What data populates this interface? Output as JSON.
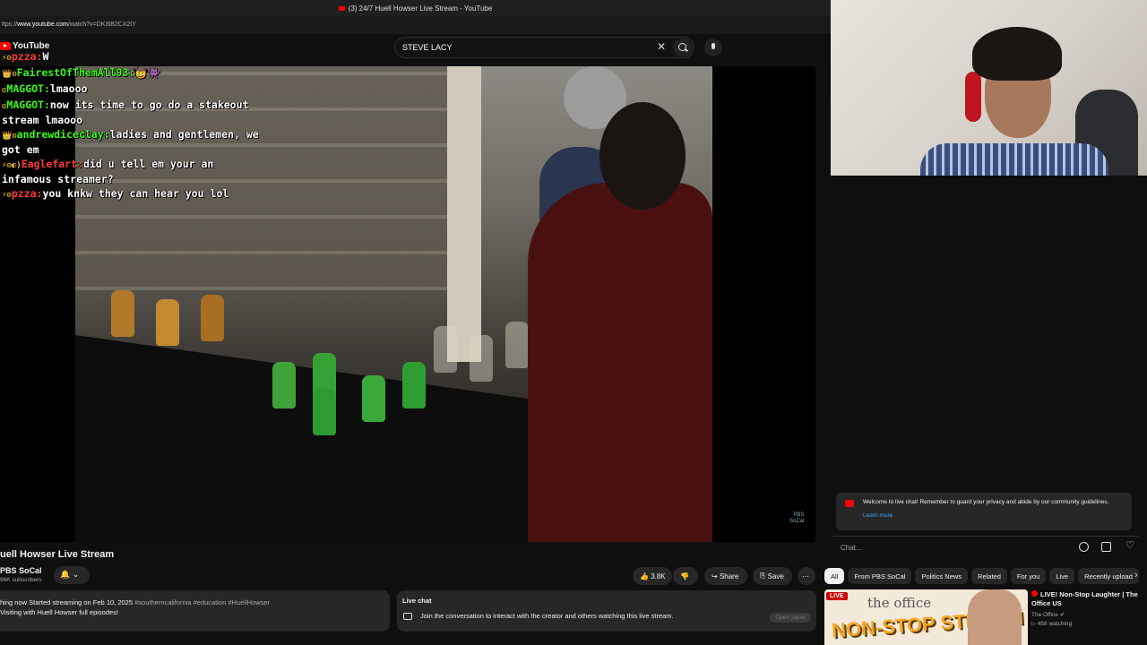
{
  "browser": {
    "tab_title": "(3) 24/7 Huell Howser Live Stream - YouTube",
    "url_prefix": "ttps://",
    "url_main": "www.youtube.com",
    "url_rest": "/watch?v=DKI6B2CX2tY"
  },
  "header": {
    "logo": "YouTube",
    "search_value": "STEVE LACY"
  },
  "chat_overlay": [
    {
      "badges": "⚡⚙",
      "user": "pzza:",
      "user_color": "#ff3b3b",
      "text": "W"
    },
    {
      "badges": "👑⚙",
      "user": "FairestOfThemAll93:",
      "user_color": "#39ff14",
      "text": "🤠👾"
    },
    {
      "badges": "◎",
      "user": "MAGGOT:",
      "user_color": "#39ff14",
      "text": "lmaooo"
    },
    {
      "badges": "◎",
      "user": "MAGGOT:",
      "user_color": "#39ff14",
      "text": "now its time to go do a stakeout stream lmaooo"
    },
    {
      "badges": "👑⚙",
      "user": "andrewdiceclay:",
      "user_color": "#39ff14",
      "text": "ladies and gentlemen, we got em"
    },
    {
      "badges": "⚡⚙◐)",
      "user": "Eaglefart:",
      "user_color": "#ff3b3b",
      "text": "did u tell em your an infamous streamer?"
    },
    {
      "badges": "⚡⚙",
      "user": "pzza:",
      "user_color": "#ff3b3b",
      "text": "you knkw they can hear you lol"
    }
  ],
  "video": {
    "watermark_line1": "PBS",
    "watermark_line2": "SoCal"
  },
  "meta": {
    "title": "uell Howser Live Stream",
    "channel": "PBS SoCal",
    "subscribers": "96K subscribers",
    "like_count": "3.8K",
    "share_label": "Share",
    "save_label": "Save",
    "description_line1_prefix": "hing now  Started streaming on Feb 10, 2025 ",
    "description_hashtags": "#southerncalifornia #education #HuellHowser",
    "description_line2": "Visiting with Huell Howser full episodes!"
  },
  "livechat_box": {
    "title": "Live chat",
    "join_text": "Join the conversation to interact with the creator and others watching this live stream.",
    "open_panel": "Open panel"
  },
  "chat_panel": {
    "welcome": "Welcome to live chat! Remember to guard your privacy and abide by our community guidelines.",
    "learn_more": "Learn more",
    "input_placeholder": "Chat..."
  },
  "chips": [
    "All",
    "From PBS SoCal",
    "Politics News",
    "Related",
    "For you",
    "Live",
    "Recently upload"
  ],
  "recommendation": {
    "live_badge": "LIVE",
    "thumb_line1": "the office",
    "thumb_line2": "NON-STOP STREAM",
    "title": "LIVE! Non-Stop Laughter | The Office US",
    "channel": "The Office",
    "watching": "458 watching"
  }
}
